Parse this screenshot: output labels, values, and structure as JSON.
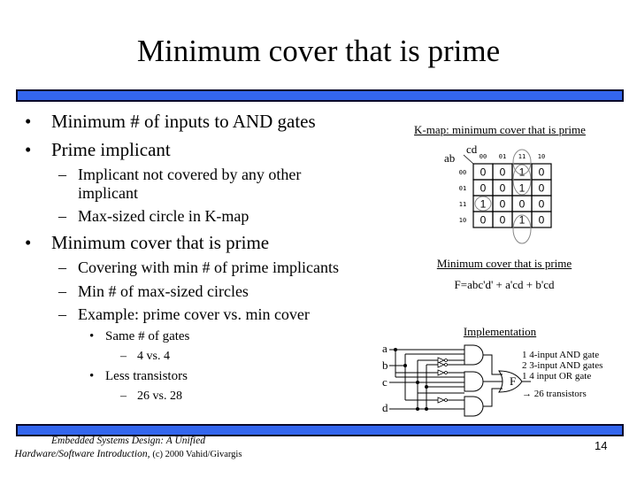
{
  "slide": {
    "title": "Minimum cover that is prime",
    "page_number": "14",
    "accent_color": "#3366ee"
  },
  "bullets": {
    "b1": "Minimum # of inputs to AND gates",
    "b2": "Prime implicant",
    "b2_sub1_line1": "Implicant not covered by any other",
    "b2_sub1_line2": "implicant",
    "b2_sub2": "Max-sized circle in K-map",
    "b3": "Minimum cover that is prime",
    "b3_sub1": "Covering with min # of prime implicants",
    "b3_sub2": "Min # of max-sized circles",
    "b3_sub3": "Example: prime cover vs. min cover",
    "b3_sub3_a": "Same # of gates",
    "b3_sub3_a_i": "4 vs. 4",
    "b3_sub3_b": "Less transistors",
    "b3_sub3_b_i": "26 vs. 28",
    "bullet_glyph": "•",
    "dash_glyph": "–"
  },
  "kmap": {
    "caption": "K-map: minimum cover that is prime",
    "row_var": "ab",
    "col_var": "cd",
    "col_headers": [
      "00",
      "01",
      "11",
      "10"
    ],
    "row_headers": [
      "00",
      "01",
      "11",
      "10"
    ],
    "cells": [
      [
        "0",
        "0",
        "1",
        "0"
      ],
      [
        "0",
        "0",
        "1",
        "0"
      ],
      [
        "1",
        "0",
        "0",
        "0"
      ],
      [
        "0",
        "0",
        "1",
        "0"
      ]
    ]
  },
  "cover": {
    "caption": "Minimum cover that is prime",
    "equation": "F=abc'd' + a'cd + b'cd"
  },
  "implementation": {
    "caption": "Implementation",
    "inputs": [
      "a",
      "b",
      "c",
      "d"
    ],
    "output": "F",
    "notes": [
      "1 4-input AND gate",
      "2 3-input AND gates",
      "1 4 input OR gate",
      "→ 26 transistors"
    ]
  },
  "footer": {
    "line1": "Embedded Systems Design: A Unified",
    "line2_italic": "Hardware/Software Introduction,",
    "line2_normal": "(c) 2000 Vahid/Givargis"
  }
}
